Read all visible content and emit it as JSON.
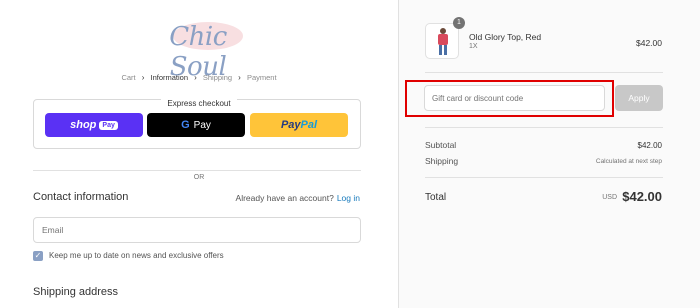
{
  "brand": {
    "logo_text": "Chic Soul",
    "logo_color": "#8aa0c4"
  },
  "breadcrumb": {
    "items": [
      {
        "label": "Cart",
        "current": false
      },
      {
        "label": "Information",
        "current": true
      },
      {
        "label": "Shipping",
        "current": false
      },
      {
        "label": "Payment",
        "current": false
      }
    ],
    "separator_icon": "chevron-right-icon"
  },
  "express_checkout": {
    "title": "Express checkout",
    "buttons": {
      "shop_pay": {
        "label": "shop",
        "badge": "Pay",
        "color": "#5a31f4"
      },
      "google_pay": {
        "icon_letter": "G",
        "label": "Pay",
        "color": "#000000"
      },
      "paypal": {
        "label_a": "Pay",
        "label_b": "Pal",
        "color": "#ffc439"
      }
    }
  },
  "divider_text": "OR",
  "contact": {
    "title": "Contact information",
    "account_prompt": "Already have an account?",
    "login_link": "Log in",
    "email_placeholder": "Email",
    "newsletter_label": "Keep me up to date on news and exclusive offers",
    "newsletter_checked": true
  },
  "shipping": {
    "title": "Shipping address"
  },
  "order_summary": {
    "product": {
      "name": "Old Glory Top, Red",
      "variant": "1X",
      "quantity": "1",
      "price": "$42.00"
    },
    "discount": {
      "placeholder": "Gift card or discount code",
      "apply_label": "Apply"
    },
    "subtotal_label": "Subtotal",
    "subtotal_value": "$42.00",
    "shipping_label": "Shipping",
    "shipping_value": "Calculated at next step",
    "total_label": "Total",
    "currency": "USD",
    "total_value": "$42.00"
  },
  "colors": {
    "accent": "#8aa0c4",
    "link": "#197bbd",
    "highlight": "#e00000"
  }
}
